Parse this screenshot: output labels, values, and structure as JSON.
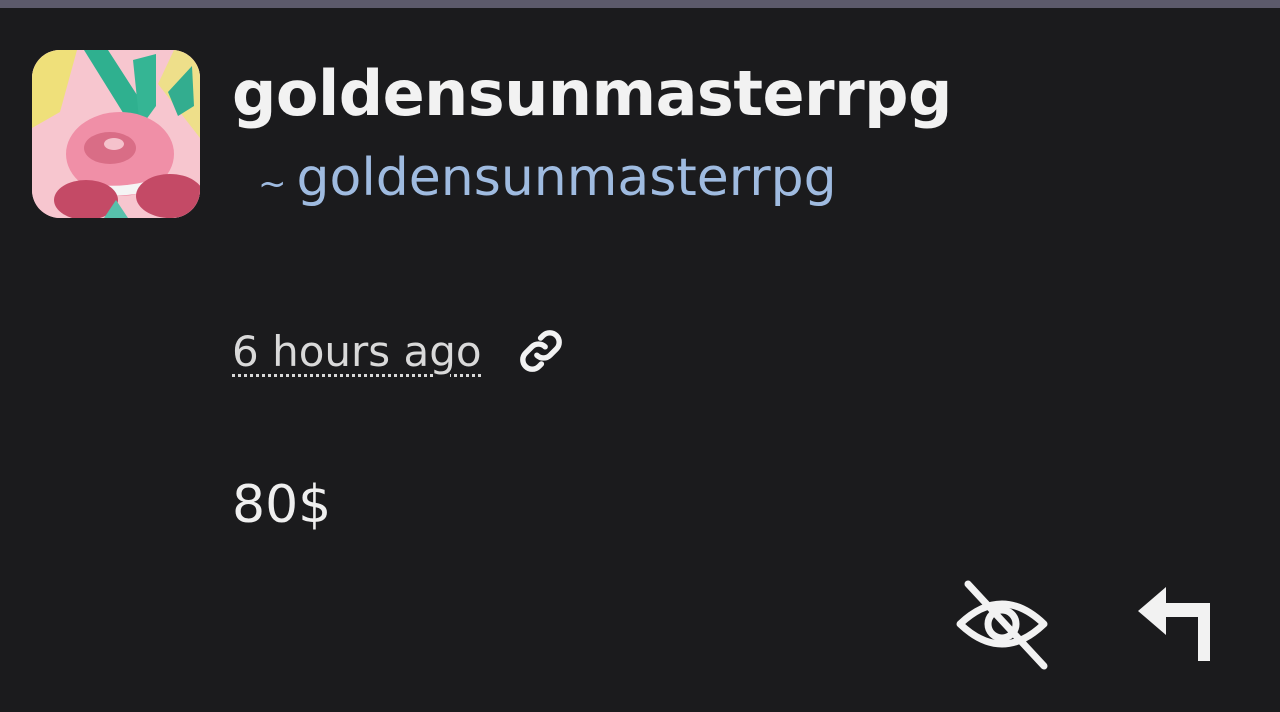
{
  "colors": {
    "background": "#1b1b1d",
    "top_strip": "#5c5a6b",
    "username": "#f2f2f2",
    "handle": "#9fbbe0",
    "text": "#efefef"
  },
  "comment": {
    "username": "goldensunmasterrpg",
    "handle_prefix": "~",
    "handle": "goldensunmasterrpg",
    "timestamp": "6 hours ago",
    "body": "80$",
    "icons": {
      "link": "link-icon",
      "hide": "eye-off-icon",
      "reply": "reply-icon"
    }
  }
}
